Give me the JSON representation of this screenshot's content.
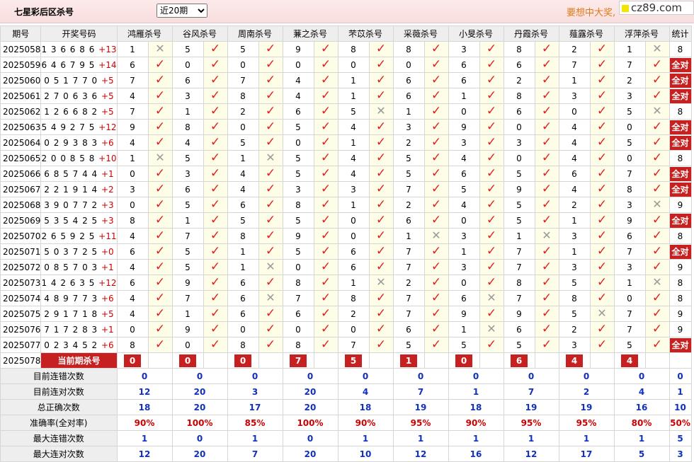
{
  "header": {
    "title": "七星彩后区杀号",
    "period_select": "近20期",
    "promo": "要想中大奖,",
    "logo": "cz89.com"
  },
  "columns": [
    "期号",
    "开奖号码",
    "鸿雁杀号",
    "谷风杀号",
    "周南杀号",
    "蒹之杀号",
    "芣苡杀号",
    "采薇杀号",
    "小旻杀号",
    "丹霞杀号",
    "薤露杀号",
    "浮萍杀号",
    "统计"
  ],
  "rows": [
    {
      "issue": "2025058",
      "nums": "1 3 6 6 8 6",
      "plus": "+13",
      "kills": [
        [
          "1",
          0
        ],
        [
          "5",
          1
        ],
        [
          "5",
          1
        ],
        [
          "9",
          1
        ],
        [
          "8",
          1
        ],
        [
          "8",
          1
        ],
        [
          "3",
          1
        ],
        [
          "8",
          1
        ],
        [
          "2",
          1
        ],
        [
          "1",
          0
        ]
      ],
      "stat": "8"
    },
    {
      "issue": "2025059",
      "nums": "6 4 6 7 9 5",
      "plus": "+14",
      "kills": [
        [
          "6",
          1
        ],
        [
          "0",
          1
        ],
        [
          "0",
          1
        ],
        [
          "0",
          1
        ],
        [
          "0",
          1
        ],
        [
          "0",
          1
        ],
        [
          "6",
          1
        ],
        [
          "6",
          1
        ],
        [
          "7",
          1
        ],
        [
          "7",
          1
        ]
      ],
      "stat": "全对"
    },
    {
      "issue": "2025060",
      "nums": "0 5 1 7 7 0",
      "plus": "+5",
      "kills": [
        [
          "7",
          1
        ],
        [
          "6",
          1
        ],
        [
          "7",
          1
        ],
        [
          "4",
          1
        ],
        [
          "1",
          1
        ],
        [
          "6",
          1
        ],
        [
          "6",
          1
        ],
        [
          "2",
          1
        ],
        [
          "1",
          1
        ],
        [
          "2",
          1
        ]
      ],
      "stat": "全对"
    },
    {
      "issue": "2025061",
      "nums": "2 7 0 6 3 6",
      "plus": "+5",
      "kills": [
        [
          "4",
          1
        ],
        [
          "3",
          1
        ],
        [
          "8",
          1
        ],
        [
          "4",
          1
        ],
        [
          "1",
          1
        ],
        [
          "6",
          1
        ],
        [
          "1",
          1
        ],
        [
          "8",
          1
        ],
        [
          "3",
          1
        ],
        [
          "3",
          1
        ]
      ],
      "stat": "全对"
    },
    {
      "issue": "2025062",
      "nums": "1 2 6 6 8 2",
      "plus": "+5",
      "kills": [
        [
          "7",
          1
        ],
        [
          "1",
          1
        ],
        [
          "2",
          1
        ],
        [
          "6",
          1
        ],
        [
          "5",
          0
        ],
        [
          "1",
          1
        ],
        [
          "0",
          1
        ],
        [
          "6",
          1
        ],
        [
          "0",
          1
        ],
        [
          "5",
          0
        ]
      ],
      "stat": "8"
    },
    {
      "issue": "2025063",
      "nums": "5 4 9 2 7 5",
      "plus": "+12",
      "kills": [
        [
          "9",
          1
        ],
        [
          "8",
          1
        ],
        [
          "0",
          1
        ],
        [
          "5",
          1
        ],
        [
          "4",
          1
        ],
        [
          "3",
          1
        ],
        [
          "9",
          1
        ],
        [
          "0",
          1
        ],
        [
          "4",
          1
        ],
        [
          "0",
          1
        ]
      ],
      "stat": "全对"
    },
    {
      "issue": "2025064",
      "nums": "0 2 9 3 8 3",
      "plus": "+6",
      "kills": [
        [
          "4",
          1
        ],
        [
          "4",
          1
        ],
        [
          "5",
          1
        ],
        [
          "0",
          1
        ],
        [
          "1",
          1
        ],
        [
          "2",
          1
        ],
        [
          "3",
          1
        ],
        [
          "3",
          1
        ],
        [
          "4",
          1
        ],
        [
          "5",
          1
        ]
      ],
      "stat": "全对"
    },
    {
      "issue": "2025065",
      "nums": "2 0 0 8 5 8",
      "plus": "+10",
      "kills": [
        [
          "1",
          0
        ],
        [
          "5",
          1
        ],
        [
          "1",
          0
        ],
        [
          "5",
          1
        ],
        [
          "4",
          1
        ],
        [
          "5",
          1
        ],
        [
          "4",
          1
        ],
        [
          "0",
          1
        ],
        [
          "4",
          1
        ],
        [
          "0",
          1
        ]
      ],
      "stat": "8"
    },
    {
      "issue": "2025066",
      "nums": "6 8 5 7 4 4",
      "plus": "+1",
      "kills": [
        [
          "0",
          1
        ],
        [
          "3",
          1
        ],
        [
          "4",
          1
        ],
        [
          "5",
          1
        ],
        [
          "4",
          1
        ],
        [
          "5",
          1
        ],
        [
          "6",
          1
        ],
        [
          "5",
          1
        ],
        [
          "6",
          1
        ],
        [
          "7",
          1
        ]
      ],
      "stat": "全对"
    },
    {
      "issue": "2025067",
      "nums": "2 2 1 9 1 4",
      "plus": "+2",
      "kills": [
        [
          "3",
          1
        ],
        [
          "6",
          1
        ],
        [
          "4",
          1
        ],
        [
          "3",
          1
        ],
        [
          "3",
          1
        ],
        [
          "7",
          1
        ],
        [
          "5",
          1
        ],
        [
          "9",
          1
        ],
        [
          "4",
          1
        ],
        [
          "8",
          1
        ]
      ],
      "stat": "全对"
    },
    {
      "issue": "2025068",
      "nums": "3 9 0 7 7 2",
      "plus": "+3",
      "kills": [
        [
          "0",
          1
        ],
        [
          "5",
          1
        ],
        [
          "6",
          1
        ],
        [
          "8",
          1
        ],
        [
          "1",
          1
        ],
        [
          "2",
          1
        ],
        [
          "4",
          1
        ],
        [
          "5",
          1
        ],
        [
          "2",
          1
        ],
        [
          "3",
          0
        ]
      ],
      "stat": "9"
    },
    {
      "issue": "2025069",
      "nums": "5 3 5 4 2 5",
      "plus": "+3",
      "kills": [
        [
          "8",
          1
        ],
        [
          "1",
          1
        ],
        [
          "5",
          1
        ],
        [
          "5",
          1
        ],
        [
          "0",
          1
        ],
        [
          "6",
          1
        ],
        [
          "0",
          1
        ],
        [
          "5",
          1
        ],
        [
          "1",
          1
        ],
        [
          "9",
          1
        ]
      ],
      "stat": "全对"
    },
    {
      "issue": "2025070",
      "nums": "2 6 5 9 2 5",
      "plus": "+11",
      "kills": [
        [
          "4",
          1
        ],
        [
          "7",
          1
        ],
        [
          "8",
          1
        ],
        [
          "9",
          1
        ],
        [
          "0",
          1
        ],
        [
          "1",
          0
        ],
        [
          "3",
          1
        ],
        [
          "1",
          0
        ],
        [
          "3",
          1
        ],
        [
          "6",
          1
        ]
      ],
      "stat": "8"
    },
    {
      "issue": "2025071",
      "nums": "5 0 3 7 2 5",
      "plus": "+0",
      "kills": [
        [
          "6",
          1
        ],
        [
          "5",
          1
        ],
        [
          "1",
          1
        ],
        [
          "5",
          1
        ],
        [
          "6",
          1
        ],
        [
          "7",
          1
        ],
        [
          "1",
          1
        ],
        [
          "7",
          1
        ],
        [
          "1",
          1
        ],
        [
          "7",
          1
        ]
      ],
      "stat": "全对"
    },
    {
      "issue": "2025072",
      "nums": "0 8 5 7 0 3",
      "plus": "+1",
      "kills": [
        [
          "4",
          1
        ],
        [
          "5",
          1
        ],
        [
          "1",
          0
        ],
        [
          "0",
          1
        ],
        [
          "6",
          1
        ],
        [
          "7",
          1
        ],
        [
          "3",
          1
        ],
        [
          "7",
          1
        ],
        [
          "3",
          1
        ],
        [
          "3",
          1
        ]
      ],
      "stat": "9"
    },
    {
      "issue": "2025073",
      "nums": "1 4 2 6 3 5",
      "plus": "+12",
      "kills": [
        [
          "6",
          1
        ],
        [
          "9",
          1
        ],
        [
          "6",
          1
        ],
        [
          "8",
          1
        ],
        [
          "1",
          0
        ],
        [
          "2",
          1
        ],
        [
          "0",
          1
        ],
        [
          "8",
          1
        ],
        [
          "5",
          1
        ],
        [
          "1",
          0
        ]
      ],
      "stat": "8"
    },
    {
      "issue": "2025074",
      "nums": "4 8 9 7 7 3",
      "plus": "+6",
      "kills": [
        [
          "4",
          1
        ],
        [
          "7",
          1
        ],
        [
          "6",
          0
        ],
        [
          "7",
          1
        ],
        [
          "8",
          1
        ],
        [
          "7",
          1
        ],
        [
          "6",
          0
        ],
        [
          "7",
          1
        ],
        [
          "8",
          1
        ],
        [
          "0",
          1
        ]
      ],
      "stat": "8"
    },
    {
      "issue": "2025075",
      "nums": "2 9 1 7 1 8",
      "plus": "+5",
      "kills": [
        [
          "4",
          1
        ],
        [
          "1",
          1
        ],
        [
          "6",
          1
        ],
        [
          "6",
          1
        ],
        [
          "2",
          1
        ],
        [
          "7",
          1
        ],
        [
          "9",
          1
        ],
        [
          "9",
          1
        ],
        [
          "5",
          0
        ],
        [
          "7",
          1
        ]
      ],
      "stat": "9"
    },
    {
      "issue": "2025076",
      "nums": "7 1 7 2 8 3",
      "plus": "+1",
      "kills": [
        [
          "0",
          1
        ],
        [
          "9",
          1
        ],
        [
          "0",
          1
        ],
        [
          "0",
          1
        ],
        [
          "0",
          1
        ],
        [
          "6",
          1
        ],
        [
          "1",
          0
        ],
        [
          "6",
          1
        ],
        [
          "2",
          1
        ],
        [
          "7",
          1
        ]
      ],
      "stat": "9"
    },
    {
      "issue": "2025077",
      "nums": "0 2 3 4 5 2",
      "plus": "+6",
      "kills": [
        [
          "8",
          1
        ],
        [
          "0",
          1
        ],
        [
          "8",
          1
        ],
        [
          "8",
          1
        ],
        [
          "7",
          1
        ],
        [
          "5",
          1
        ],
        [
          "5",
          1
        ],
        [
          "5",
          1
        ],
        [
          "3",
          1
        ],
        [
          "5",
          1
        ]
      ],
      "stat": "全对"
    }
  ],
  "current": {
    "issue": "2025078",
    "label": "当前期杀号",
    "values": [
      "0",
      "0",
      "0",
      "7",
      "5",
      "1",
      "0",
      "6",
      "4",
      "4"
    ]
  },
  "stats": [
    {
      "label": "目前连错次数",
      "values": [
        "0",
        "0",
        "0",
        "0",
        "0",
        "0",
        "0",
        "0",
        "0",
        "0",
        "0"
      ],
      "kind": "num"
    },
    {
      "label": "目前连对次数",
      "values": [
        "12",
        "20",
        "3",
        "20",
        "4",
        "7",
        "1",
        "7",
        "2",
        "4",
        "1"
      ],
      "kind": "num"
    },
    {
      "label": "总正确次数",
      "values": [
        "18",
        "20",
        "17",
        "20",
        "18",
        "19",
        "18",
        "19",
        "19",
        "16",
        "10"
      ],
      "kind": "num"
    },
    {
      "label": "准确率(全对率)",
      "values": [
        "90%",
        "100%",
        "85%",
        "100%",
        "90%",
        "95%",
        "90%",
        "95%",
        "95%",
        "80%",
        "50%"
      ],
      "kind": "rate"
    },
    {
      "label": "最大连错次数",
      "values": [
        "1",
        "0",
        "1",
        "0",
        "1",
        "1",
        "1",
        "1",
        "1",
        "1",
        "5"
      ],
      "kind": "num"
    },
    {
      "label": "最大连对次数",
      "values": [
        "12",
        "20",
        "7",
        "20",
        "10",
        "12",
        "16",
        "12",
        "17",
        "5",
        "3"
      ],
      "kind": "num"
    }
  ],
  "colors": {
    "accent": "#c62020",
    "ok": "#e02020",
    "bad": "#9a9a9a",
    "stat_blue": "#1030c0",
    "promo": "#e07a1a"
  }
}
